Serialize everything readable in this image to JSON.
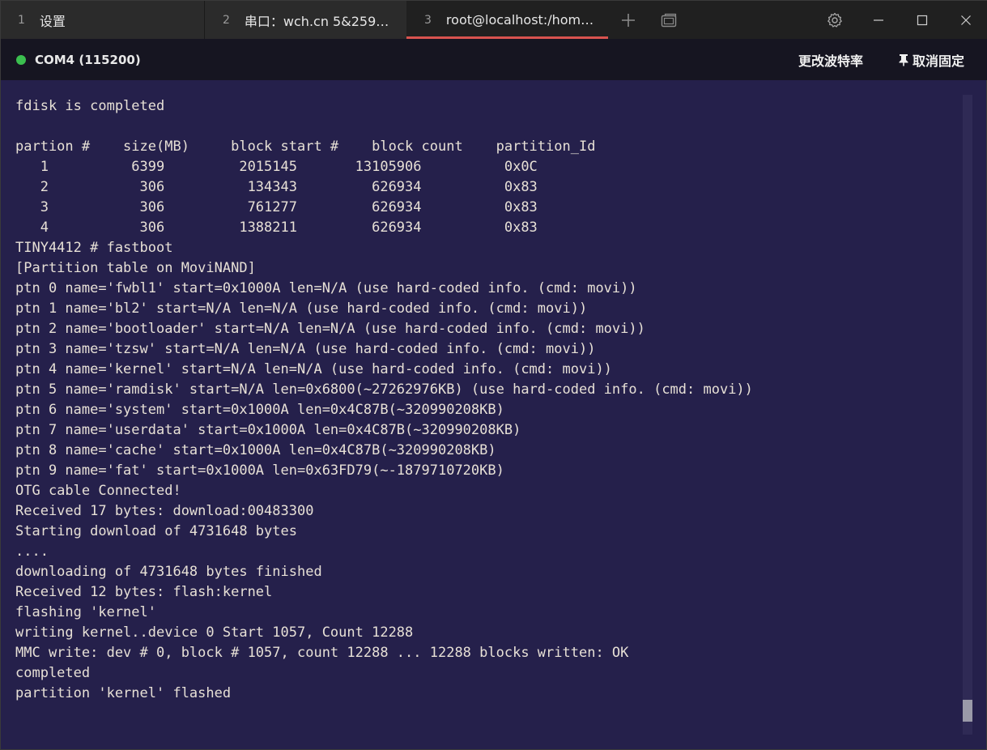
{
  "tabs": [
    {
      "num": "1",
      "title": "设置"
    },
    {
      "num": "2",
      "title": "串口：wch.cn 5&259e…"
    },
    {
      "num": "3",
      "title": "root@localhost:/home…"
    }
  ],
  "icons": {
    "new_tab": "plus-icon",
    "tab_overview": "tabs-icon",
    "settings": "gear-icon",
    "minimize": "minimize-icon",
    "maximize": "maximize-icon",
    "close": "close-icon",
    "pin": "pin-icon"
  },
  "toolbar": {
    "port": "COM4 (115200)",
    "status_color": "#3bbf4f",
    "change_baud": "更改波特率",
    "unpin": "取消固定"
  },
  "terminal": {
    "lines": [
      "fdisk is completed",
      "",
      "partion #    size(MB)     block start #    block count    partition_Id",
      "   1          6399         2015145       13105906          0x0C",
      "   2           306          134343         626934          0x83",
      "   3           306          761277         626934          0x83",
      "   4           306         1388211         626934          0x83",
      "TINY4412 # fastboot",
      "[Partition table on MoviNAND]",
      "ptn 0 name='fwbl1' start=0x1000A len=N/A (use hard-coded info. (cmd: movi))",
      "ptn 1 name='bl2' start=N/A len=N/A (use hard-coded info. (cmd: movi))",
      "ptn 2 name='bootloader' start=N/A len=N/A (use hard-coded info. (cmd: movi))",
      "ptn 3 name='tzsw' start=N/A len=N/A (use hard-coded info. (cmd: movi))",
      "ptn 4 name='kernel' start=N/A len=N/A (use hard-coded info. (cmd: movi))",
      "ptn 5 name='ramdisk' start=N/A len=0x6800(~27262976KB) (use hard-coded info. (cmd: movi))",
      "ptn 6 name='system' start=0x1000A len=0x4C87B(~320990208KB)",
      "ptn 7 name='userdata' start=0x1000A len=0x4C87B(~320990208KB)",
      "ptn 8 name='cache' start=0x1000A len=0x4C87B(~320990208KB)",
      "ptn 9 name='fat' start=0x1000A len=0x63FD79(~-1879710720KB)",
      "OTG cable Connected!",
      "Received 17 bytes: download:00483300",
      "Starting download of 4731648 bytes",
      "....",
      "downloading of 4731648 bytes finished",
      "Received 12 bytes: flash:kernel",
      "flashing 'kernel'",
      "writing kernel..device 0 Start 1057, Count 12288",
      "MMC write: dev # 0, block # 1057, count 12288 ... 12288 blocks written: OK",
      "completed",
      "partition 'kernel' flashed"
    ]
  }
}
